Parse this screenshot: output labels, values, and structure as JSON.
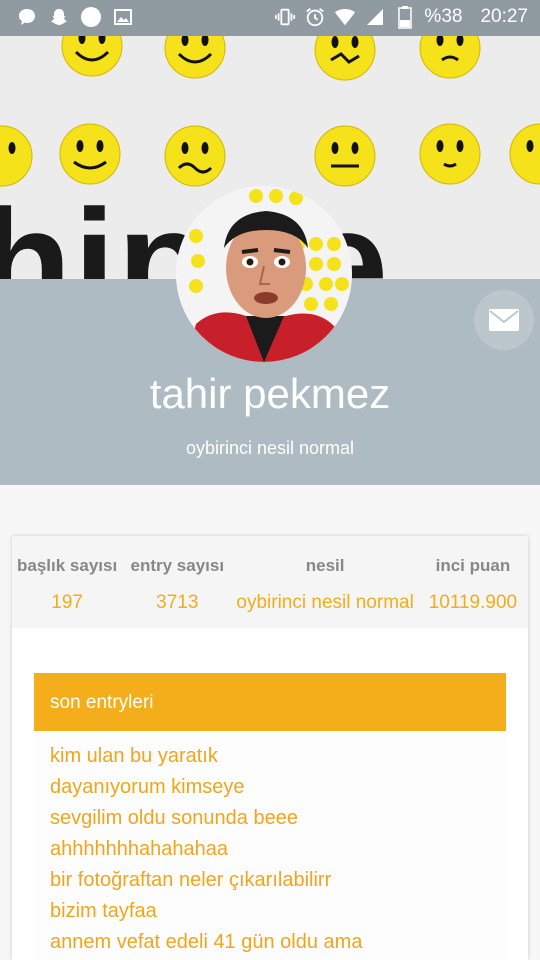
{
  "status_bar": {
    "battery": "%38",
    "time": "20:27"
  },
  "profile": {
    "username": "tahir pekmez",
    "generation": "oybirinci nesil normal"
  },
  "stats": [
    {
      "label": "başlık sayısı",
      "value": "197"
    },
    {
      "label": "entry sayısı",
      "value": "3713"
    },
    {
      "label": "nesil",
      "value": "oybirinci nesil normal"
    },
    {
      "label": "inci puan",
      "value": "10119.900"
    }
  ],
  "entries": {
    "title": "son entryleri",
    "items": [
      "kim ulan bu yaratık",
      "dayanıyorum kimseye",
      "sevgilim oldu sonunda beee",
      "ahhhhhhhahahahaa",
      "bir fotoğraftan neler çıkarılabilirr",
      "bizim tayfaa",
      "annem vefat edeli 41 gün oldu ama"
    ]
  },
  "colors": {
    "accent": "#f4ae1b",
    "band": "#aebbc2",
    "status_bar": "#8f9aa1"
  }
}
